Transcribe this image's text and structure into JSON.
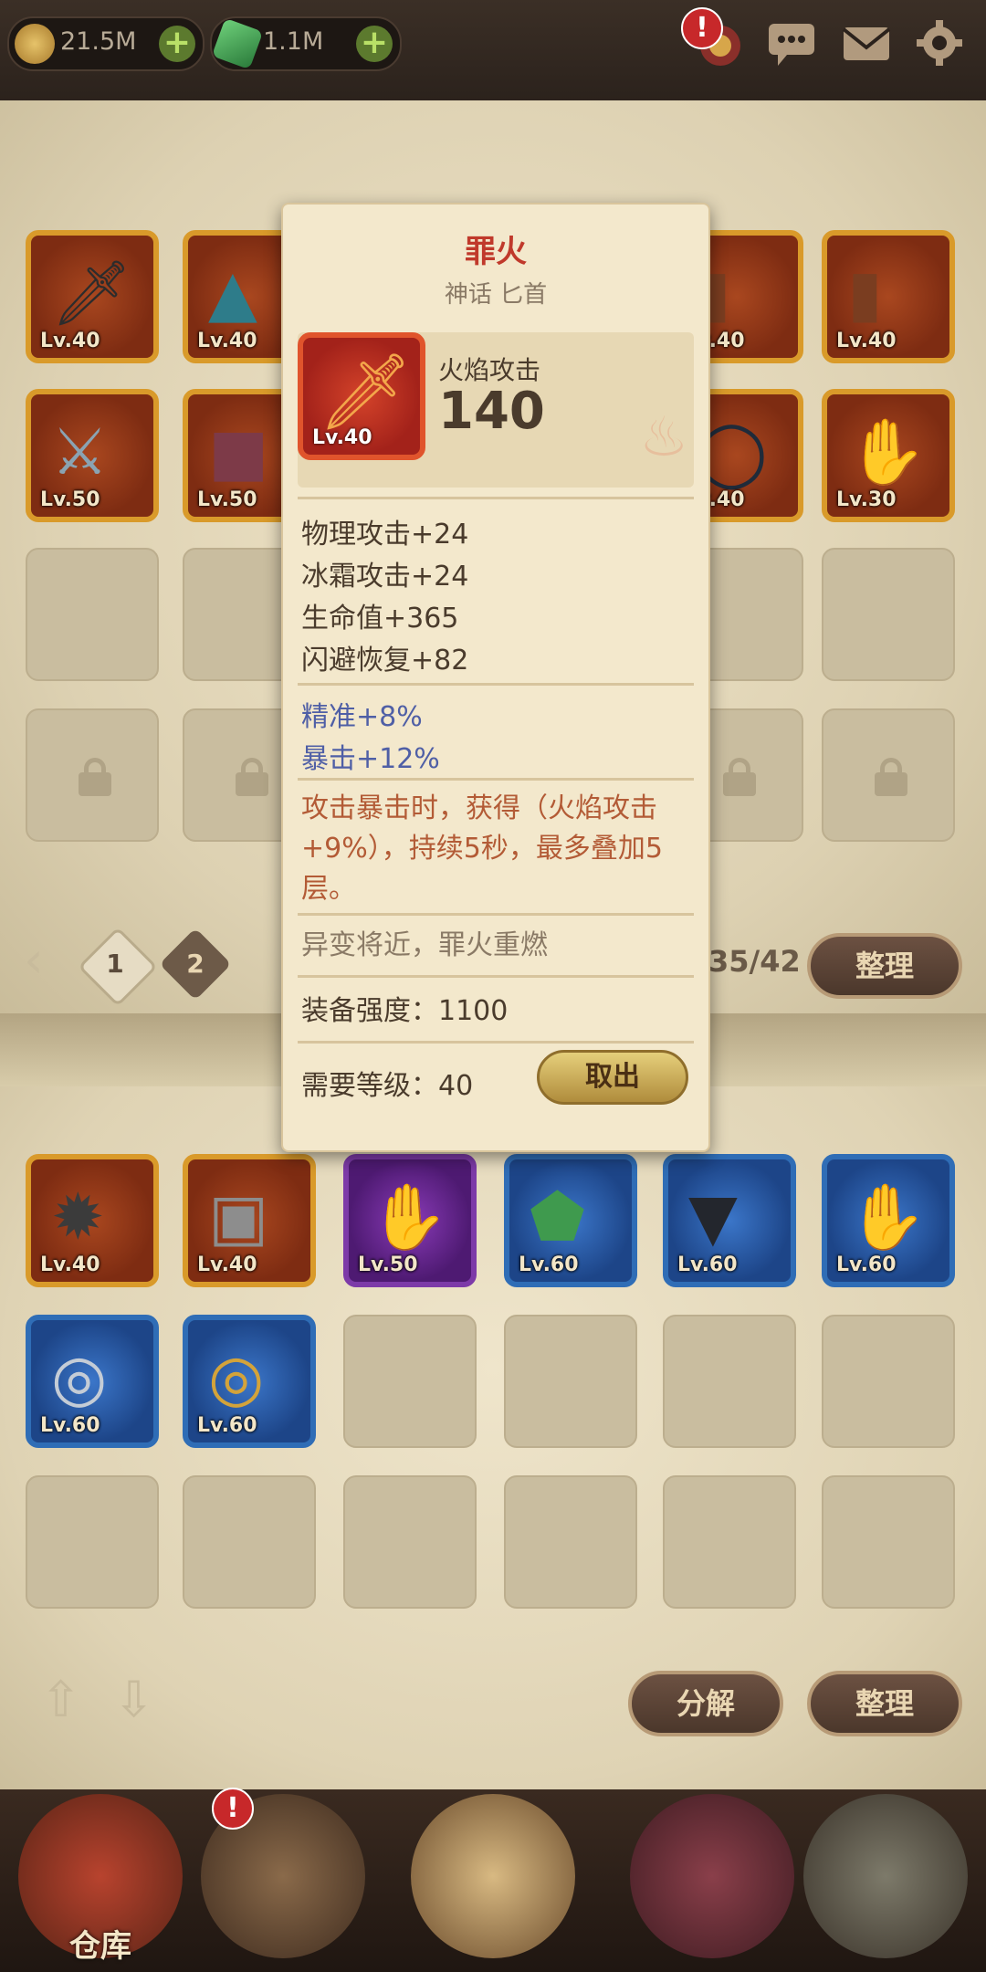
{
  "resources": {
    "gold": "21.5M",
    "gems": "1.1M"
  },
  "grid_top": {
    "row1": [
      "Lv.40",
      "Lv.40",
      "Lv.40",
      "Lv.40"
    ],
    "row2": [
      "Lv.50",
      "Lv.50",
      "Lv.40",
      "Lv.30"
    ]
  },
  "pagination": {
    "page1": "1",
    "page2": "2",
    "count": "35/42",
    "sort_label": "整理"
  },
  "grid_bottom": {
    "row1": [
      "Lv.40",
      "Lv.40",
      "Lv.50",
      "Lv.60",
      "Lv.60",
      "Lv.60"
    ],
    "row2": [
      "Lv.60",
      "Lv.60"
    ]
  },
  "bottom_actions": {
    "decompose": "分解",
    "sort": "整理"
  },
  "nav": {
    "warehouse": "仓库"
  },
  "tooltip": {
    "name": "罪火",
    "type": "神话 匕首",
    "level": "Lv.40",
    "main_attr_label": "火焰攻击",
    "main_attr_value": "140",
    "stats": [
      "物理攻击+24",
      "冰霜攻击+24",
      "生命值+365",
      "闪避恢复+82"
    ],
    "special_stats": [
      "精准+8%",
      "暴击+12%"
    ],
    "effect": "攻击暴击时，获得（火焰攻击+9%），持续5秒，最多叠加5层。",
    "flavor": "异变将近，罪火重燃",
    "power": "装备强度：1100",
    "required_level": "需要等级：40",
    "unequip_label": "取出"
  },
  "colors": {
    "legendary_title": "#c0392b",
    "effect_text": "#b35b36",
    "special_stat": "#4f5fa6"
  }
}
